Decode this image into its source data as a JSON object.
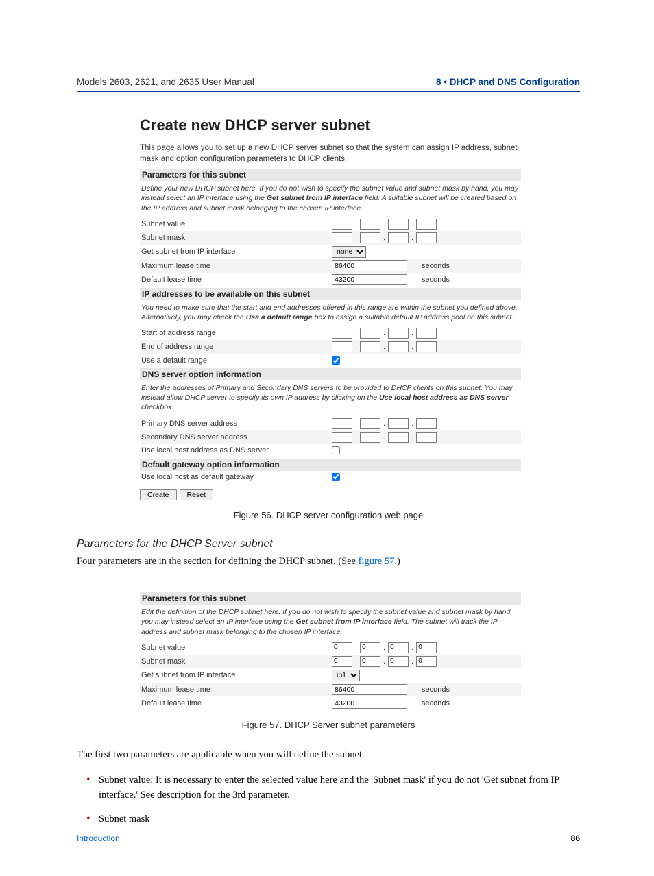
{
  "header": {
    "left": "Models 2603, 2621, and 2635 User Manual",
    "right": "8 • DHCP and DNS Configuration"
  },
  "fig56": {
    "title": "Create new DHCP server subnet",
    "intro": "This page allows you to set up a new DHCP server subnet so that the system can assign IP address, subnet mask and option configuration parameters to DHCP clients.",
    "s1": {
      "head": "Parameters for this subnet",
      "desc_a": "Define your new DHCP subnet here. If you do not wish to specify the subnet value and subnet mask by hand, you may instead select an IP interface using the ",
      "desc_bold": "Get subnet from IP interface",
      "desc_b": " field. A suitable subnet will be created based on the IP address and subnet mask belonging to the chosen IP interface.",
      "r1": "Subnet value",
      "r2": "Subnet mask",
      "r3": "Get subnet from IP interface",
      "r3_sel": "none",
      "r4": "Maximum lease time",
      "r4_val": "86400",
      "r5": "Default lease time",
      "r5_val": "43200",
      "unit": "seconds"
    },
    "s2": {
      "head": "IP addresses to be available on this subnet",
      "desc_a": "You need to make sure that the start and end addresses offered in this range are within the subnet you defined above. Alternatively, you may check the ",
      "desc_bold": "Use a default range",
      "desc_b": " box to assign a suitable default IP address pool on this subnet.",
      "r1": "Start of address range",
      "r2": "End of address range",
      "r3": "Use a default range"
    },
    "s3": {
      "head": "DNS server option information",
      "desc_a": "Enter the addresses of Primary and Secondary DNS servers to be provided to DHCP clients on this subnet. You may instead allow DHCP server to specify its own IP address by clicking on the ",
      "desc_bold": "Use local host address as DNS server",
      "desc_b": " checkbox.",
      "r1": "Primary DNS server address",
      "r2": "Secondary DNS server address",
      "r3": "Use local host address as DNS server"
    },
    "s4": {
      "head": "Default gateway option information",
      "r1": "Use local host as default gateway"
    },
    "btn1": "Create",
    "btn2": "Reset",
    "caption": "Figure 56. DHCP server configuration web page"
  },
  "section": {
    "heading": "Parameters for the DHCP Server subnet",
    "para_a": "Four parameters are in the section for defining the DHCP subnet. (See ",
    "para_link": "figure 57",
    "para_b": ".)"
  },
  "fig57": {
    "head": "Parameters for this subnet",
    "desc_a": "Edit the definition of the DHCP subnet here. If you do not wish to specify the subnet value and subnet mask by hand, you may instead select an IP interface using the ",
    "desc_bold": "Get subnet from IP interface",
    "desc_b": " field. The subnet will track the IP address and subnet mask belonging to the chosen IP interface.",
    "r1": "Subnet value",
    "r2": "Subnet mask",
    "r3": "Get subnet from IP interface",
    "r3_sel": "ip1",
    "r4": "Maximum lease time",
    "r4_val": "86400",
    "r5": "Default lease time",
    "r5_val": "43200",
    "unit": "seconds",
    "ip_val": "0",
    "caption": "Figure 57. DHCP Server subnet parameters"
  },
  "after": {
    "p": "The first two parameters are applicable when you will define the subnet.",
    "b1": "Subnet value: It is necessary to enter the selected value here and the 'Subnet mask' if you do not 'Get subnet from IP interface.' See description for the 3rd parameter.",
    "b2": "Subnet mask"
  },
  "footer": {
    "left": "Introduction",
    "right": "86"
  }
}
